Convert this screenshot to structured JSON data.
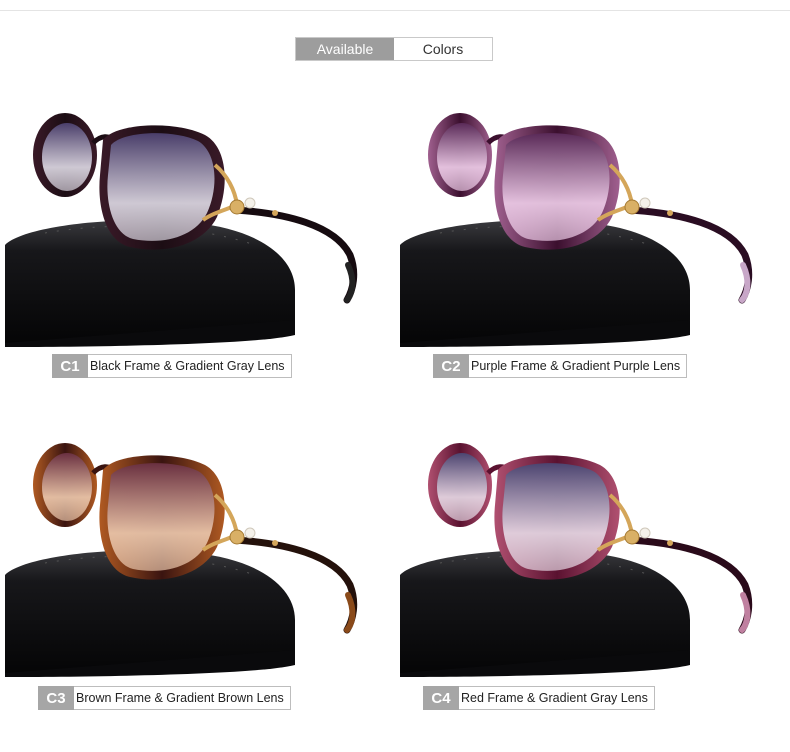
{
  "tabs": [
    {
      "label": "Available",
      "active": true
    },
    {
      "label": "Colors",
      "active": false
    }
  ],
  "variants": [
    {
      "code": "C1",
      "description": "Black Frame & Gradient Gray Lens",
      "frame_color": "#1c0d14",
      "frame_edge": "#3a1a28",
      "lens_top": "#4a3e6a",
      "lens_bottom": "#d7d2dd",
      "temple_color": "#160b10",
      "temple_tip": "#222222"
    },
    {
      "code": "C2",
      "description": "Purple Frame & Gradient Purple Lens",
      "frame_color": "#3b0f2e",
      "frame_edge": "#a0608f",
      "lens_top": "#5a2a58",
      "lens_bottom": "#e9c7e3",
      "temple_color": "#2a0d22",
      "temple_tip": "#c8a7c8"
    },
    {
      "code": "C3",
      "description": "Brown Frame & Gradient Brown Lens",
      "frame_color": "#3a1410",
      "frame_edge": "#b05a22",
      "lens_top": "#6a3040",
      "lens_bottom": "#e8c3a8",
      "temple_color": "#24110b",
      "temple_tip": "#8a4a1a"
    },
    {
      "code": "C4",
      "description": "Red Frame & Gradient Gray Lens",
      "frame_color": "#5a1230",
      "frame_edge": "#b05070",
      "lens_top": "#4c4470",
      "lens_bottom": "#e3d3e0",
      "temple_color": "#2a0a1a",
      "temple_tip": "#c080a0"
    }
  ]
}
